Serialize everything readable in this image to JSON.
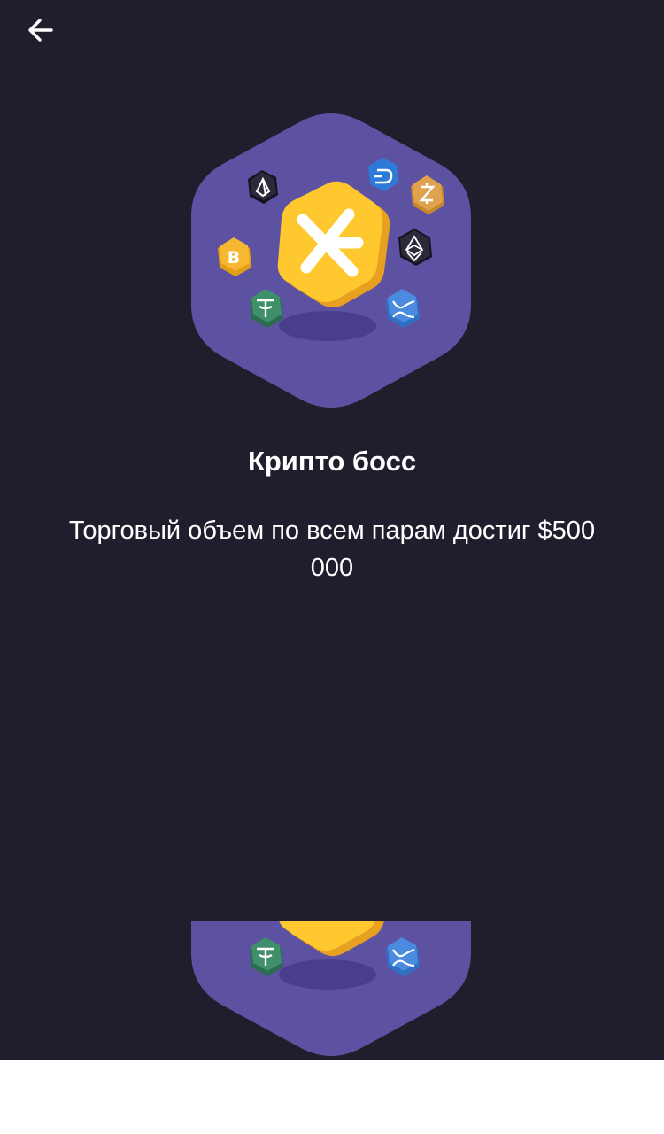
{
  "header": {
    "back_icon": "arrow-left-icon"
  },
  "badge": {
    "icon": "crypto-boss-badge-icon",
    "colors": {
      "hexagon": "#5d52a2",
      "center_coin": "#ffc82e",
      "bitcoin": "#f7b731",
      "tether": "#3f8f6b",
      "dash": "#2e7ad8",
      "zcash": "#e0a24c",
      "eos": "#2b2a3a",
      "ethereum": "#2b2a3a",
      "xrp": "#4a8be0"
    }
  },
  "achievement": {
    "title": "Крипто босс",
    "description": "Торговый объем по всем парам достиг $500 000"
  },
  "theme": {
    "background": "#1f1e2c",
    "text": "#ffffff"
  }
}
